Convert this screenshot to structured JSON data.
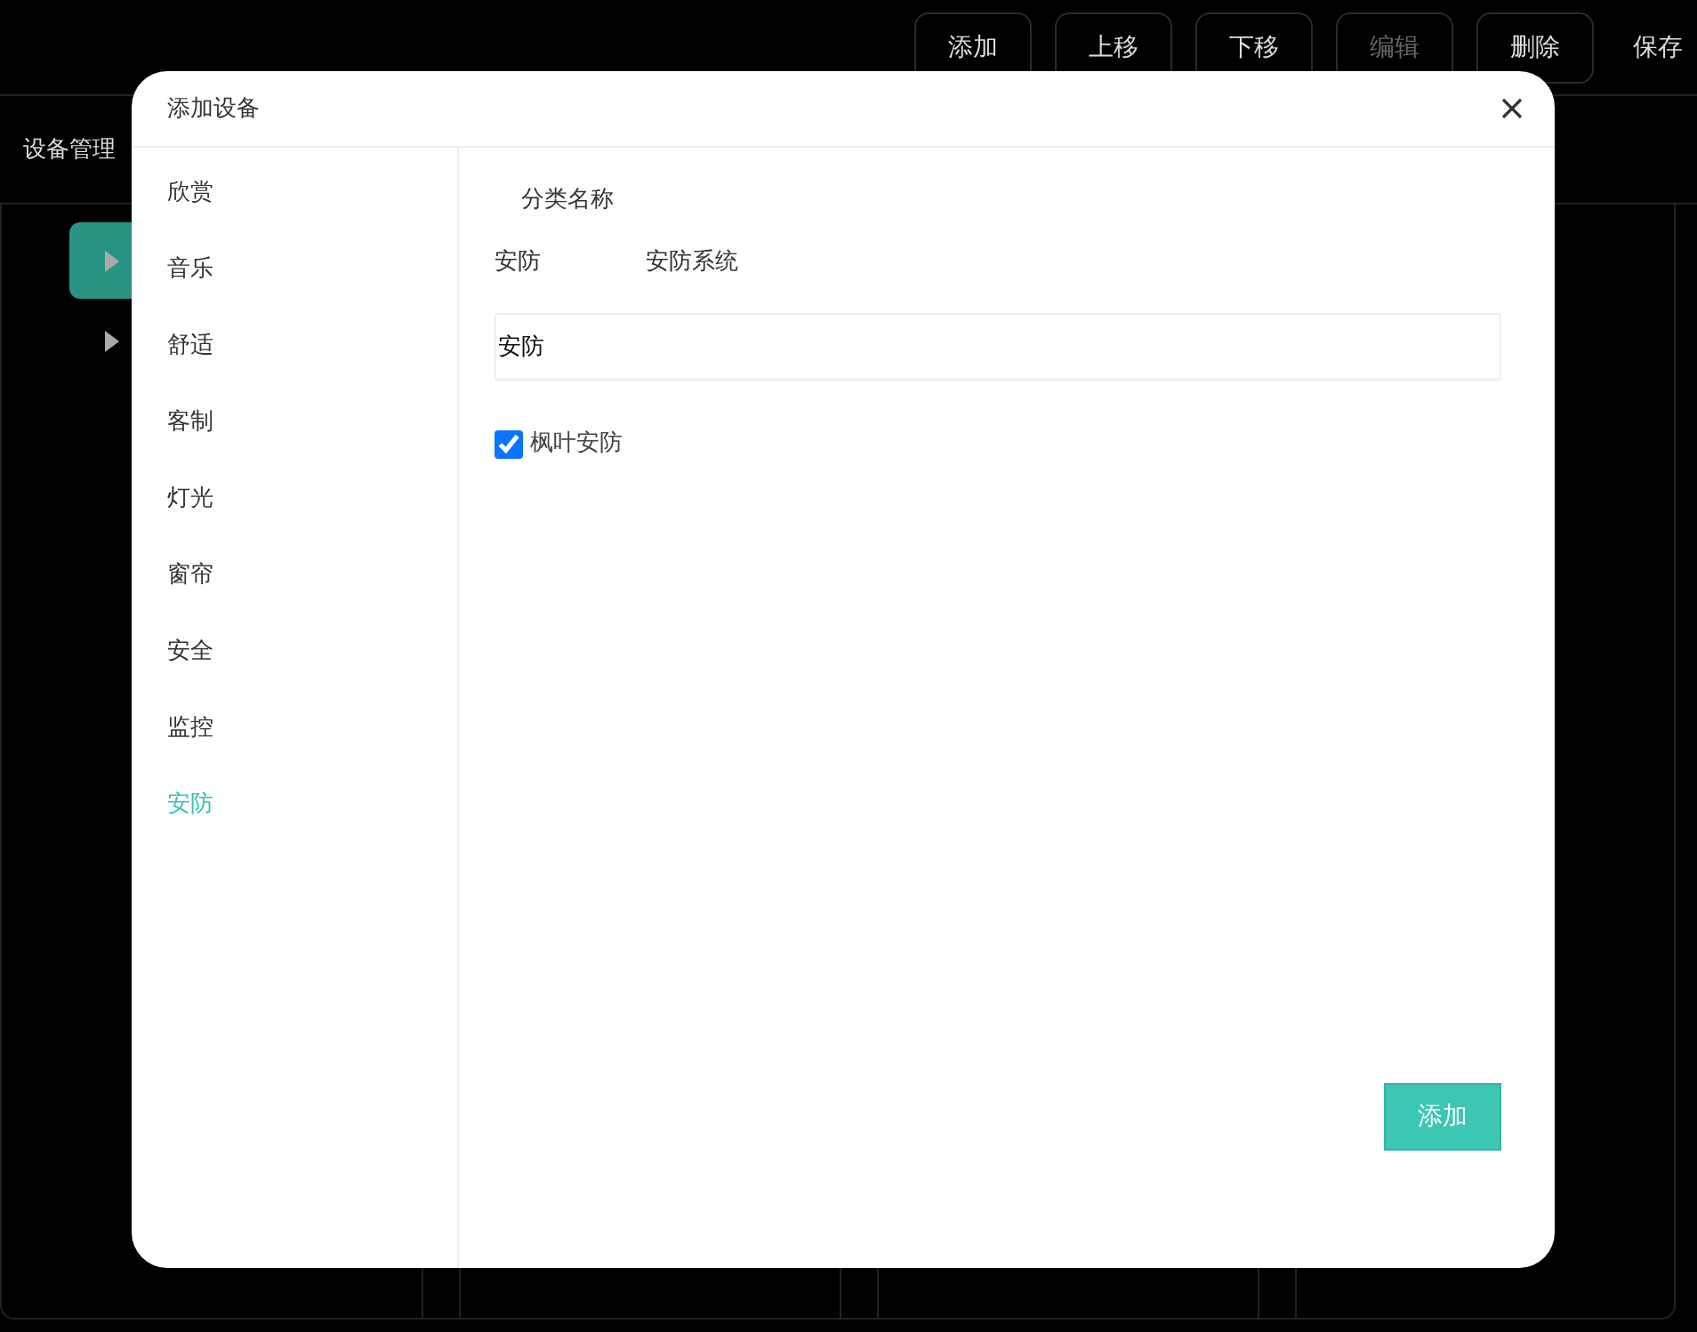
{
  "toolbar": {
    "buttons": [
      {
        "label": "添加",
        "kind": "outlined",
        "disabled": false
      },
      {
        "label": "上移",
        "kind": "outlined",
        "disabled": false
      },
      {
        "label": "下移",
        "kind": "outlined",
        "disabled": false
      },
      {
        "label": "编辑",
        "kind": "outlined",
        "disabled": true
      },
      {
        "label": "删除",
        "kind": "outlined",
        "disabled": false
      },
      {
        "label": "保存",
        "kind": "plain",
        "disabled": false
      }
    ]
  },
  "page": {
    "title": "设备管理"
  },
  "tree": {
    "items": [
      {
        "selected": true
      },
      {
        "selected": false
      }
    ]
  },
  "dialog": {
    "title": "添加设备",
    "categories": [
      {
        "label": "欣赏",
        "selected": false
      },
      {
        "label": "音乐",
        "selected": false
      },
      {
        "label": "舒适",
        "selected": false
      },
      {
        "label": "客制",
        "selected": false
      },
      {
        "label": "灯光",
        "selected": false
      },
      {
        "label": "窗帘",
        "selected": false
      },
      {
        "label": "安全",
        "selected": false
      },
      {
        "label": "监控",
        "selected": false
      },
      {
        "label": "安防",
        "selected": true
      }
    ],
    "field_label": "分类名称",
    "category_row": [
      "安防",
      "安防系统"
    ],
    "name_field": {
      "value": "安防"
    },
    "checkbox": {
      "label": "枫叶安防",
      "checked": true
    },
    "submit_button": "添加"
  }
}
